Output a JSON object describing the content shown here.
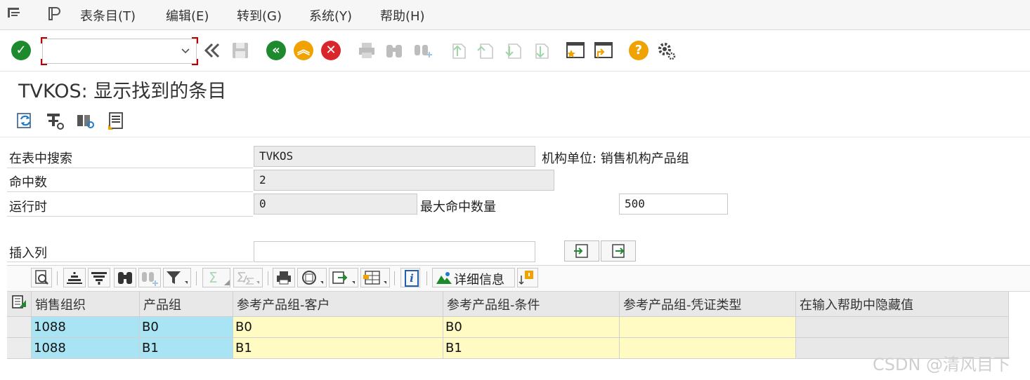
{
  "menu": {
    "items": [
      "表条目(T)",
      "编辑(E)",
      "转到(G)",
      "系统(Y)",
      "帮助(H)"
    ]
  },
  "toolbar": {
    "command_field_value": "",
    "icons": [
      "enter-check-icon",
      "back-double-chevron-icon",
      "save-icon",
      "back-icon",
      "exit-icon",
      "cancel-icon",
      "print-icon",
      "find-icon",
      "find-next-icon",
      "first-page-icon",
      "previous-page-icon",
      "next-page-icon",
      "last-page-icon",
      "create-session-icon",
      "shortcut-icon",
      "help-icon",
      "settings-gear-icon"
    ],
    "colors": {
      "green": "#1e8a2e",
      "orange": "#f0a300",
      "red": "#d9262b"
    }
  },
  "page": {
    "title": "TVKOS: 显示找到的条目"
  },
  "secondary_toolbar": {
    "icons": [
      "refresh-icon",
      "change-settings-icon",
      "field-selection-icon",
      "document-icon"
    ]
  },
  "form": {
    "table_search_label": "在表中搜索",
    "table_search_value": "TVKOS",
    "table_description": "机构单位: 销售机构产品组",
    "hits_label": "命中数",
    "hits_value": "2",
    "runtime_label": "运行时",
    "runtime_value": "0",
    "max_hits_label": "最大命中数量",
    "max_hits_value": "500",
    "insert_column_label": "插入列",
    "insert_column_value": ""
  },
  "alv_toolbar": {
    "details_label": "详细信息",
    "sum_symbol": "Σ",
    "info_symbol": "i"
  },
  "grid": {
    "columns": [
      "销售组织",
      "产品组",
      "参考产品组-客户",
      "参考产品组-条件",
      "参考产品组-凭证类型",
      "在输入帮助中隐藏值"
    ],
    "rows": [
      [
        "1088",
        "B0",
        "B0",
        "B0",
        "",
        ""
      ],
      [
        "1088",
        "B1",
        "B1",
        "B1",
        "",
        ""
      ]
    ]
  },
  "watermark": "CSDN @清风目下"
}
